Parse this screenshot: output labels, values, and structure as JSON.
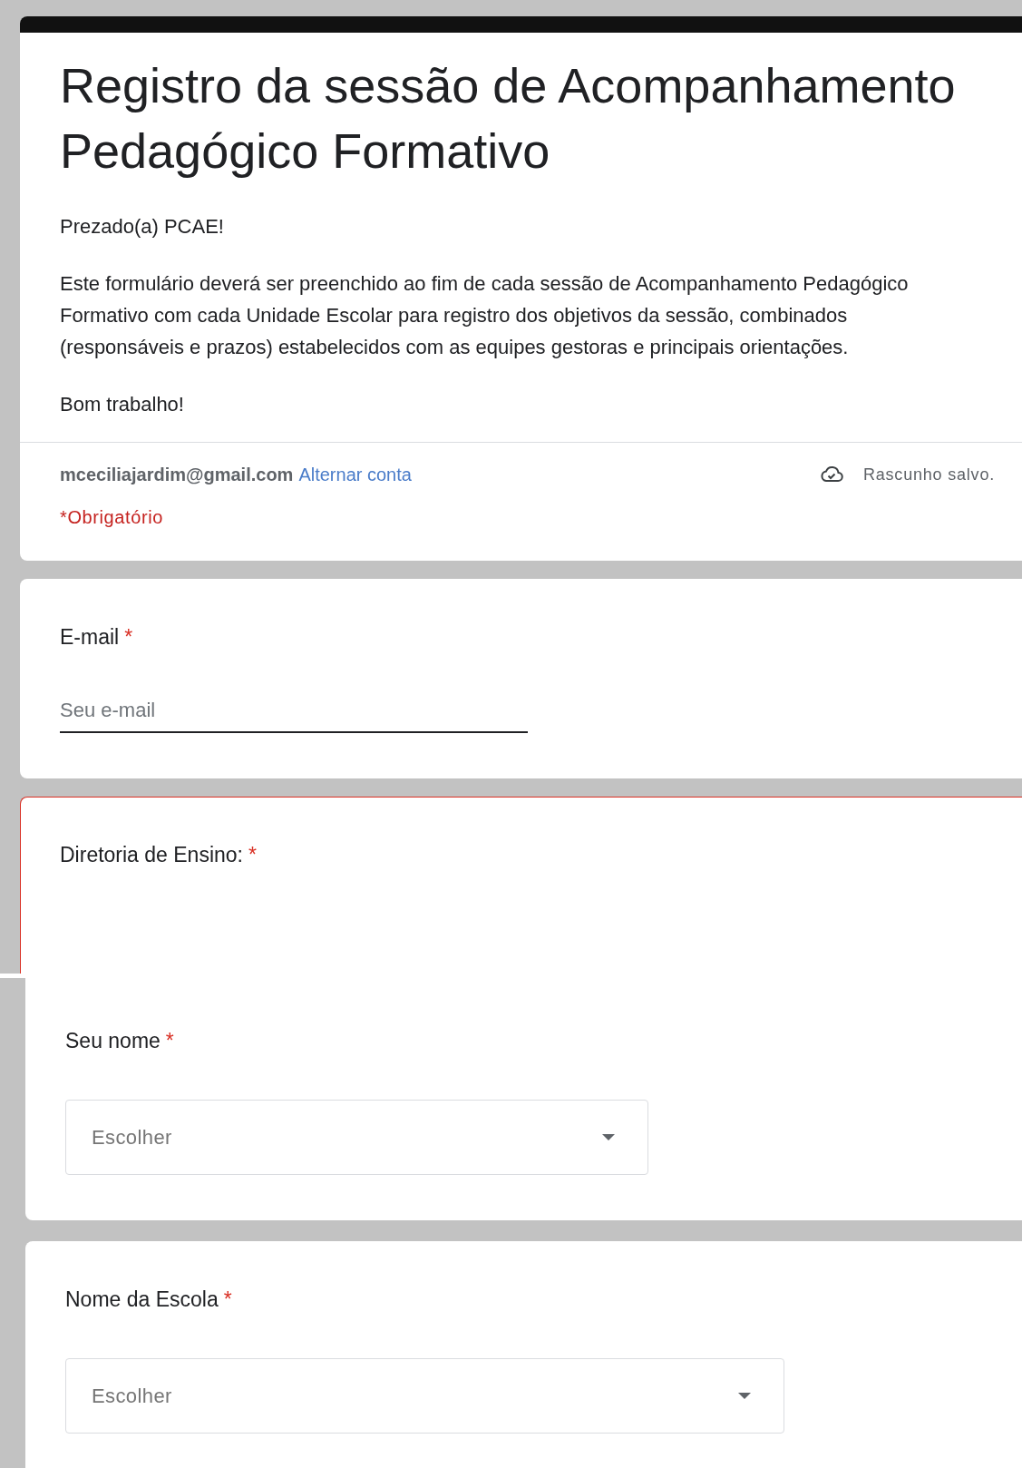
{
  "form": {
    "title": "Registro da sessão de Acompanhamento Pedagógico Formativo",
    "description": [
      "Prezado(a) PCAE!",
      "Este formulário deverá ser preenchido ao fim de cada sessão de Acompanhamento Pedagógico Formativo com cada Unidade Escolar para registro dos objetivos da sessão, combinados (responsáveis e prazos) estabelecidos com as equipes gestoras e principais orientações.",
      "Bom trabalho!"
    ],
    "account": {
      "email": "mceciliajardim@gmail.com",
      "switch_link": "Alternar conta",
      "draft_status": "Rascunho salvo."
    },
    "required_note": "*Obrigatório",
    "questions": [
      {
        "kind": "short_answer",
        "label": "E-mail",
        "required_mark": "*",
        "placeholder": "Seu e-mail",
        "focused": true,
        "error": false
      },
      {
        "kind": "label_only",
        "label": "Diretoria de Ensino:",
        "required_mark": "*",
        "error": true
      }
    ]
  },
  "form_continued": {
    "questions": [
      {
        "kind": "dropdown",
        "label": "Seu nome",
        "required_mark": "*",
        "placeholder": "Escolher",
        "error": false
      },
      {
        "kind": "dropdown",
        "label": "Nome da Escola",
        "required_mark": "*",
        "placeholder": "Escolher",
        "error": false
      }
    ]
  }
}
